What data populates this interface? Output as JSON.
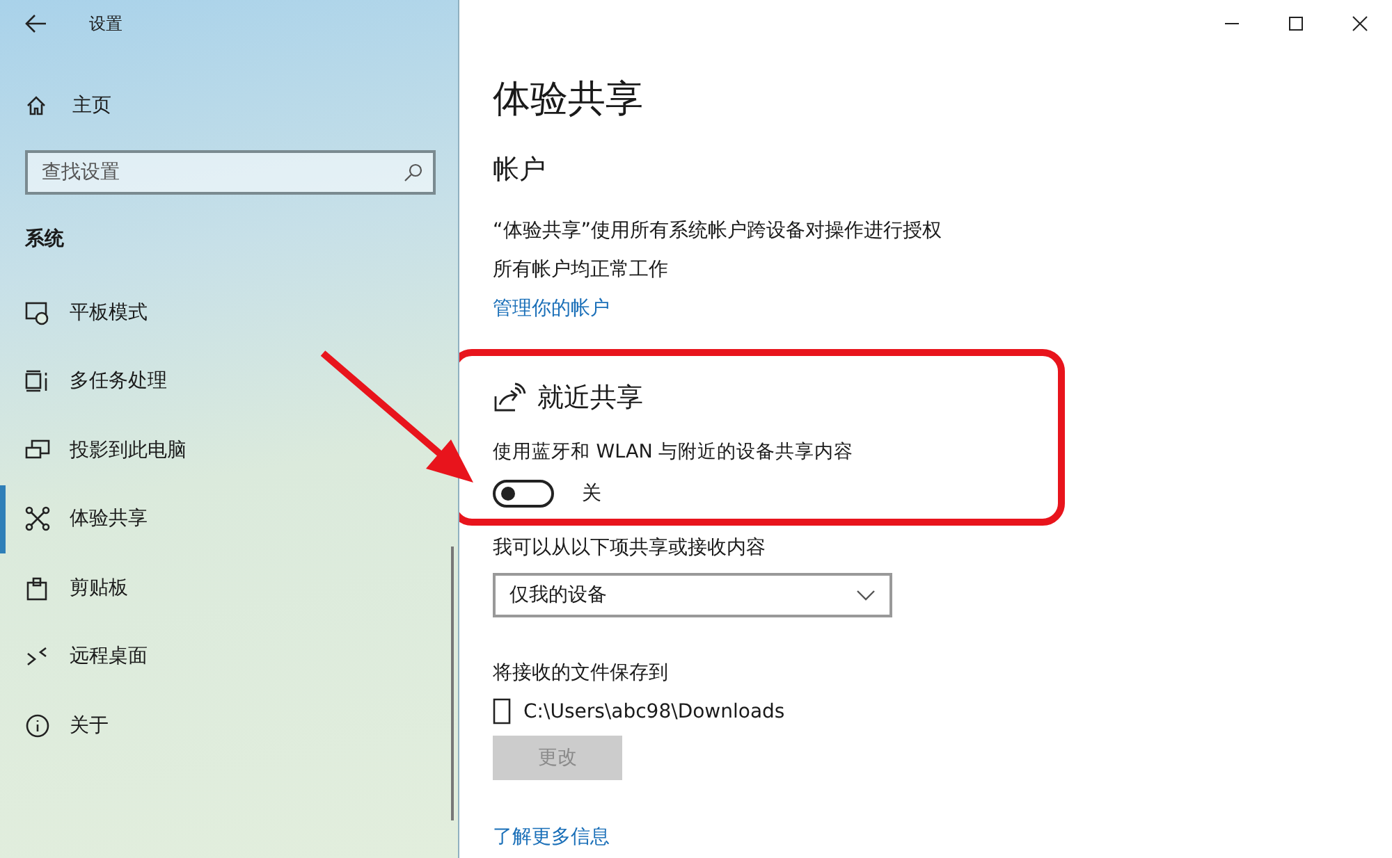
{
  "window": {
    "title": "设置"
  },
  "sidebar": {
    "home": "主页",
    "search": {
      "placeholder": "查找设置"
    },
    "section": "系统",
    "items": [
      {
        "label": "平板模式",
        "selected": false
      },
      {
        "label": "多任务处理",
        "selected": false
      },
      {
        "label": "投影到此电脑",
        "selected": false
      },
      {
        "label": "体验共享",
        "selected": true
      },
      {
        "label": "剪贴板",
        "selected": false
      },
      {
        "label": "远程桌面",
        "selected": false
      },
      {
        "label": "关于",
        "selected": false
      }
    ]
  },
  "page": {
    "title": "体验共享",
    "account": {
      "heading": "帐户",
      "lines": [
        "“体验共享”使用所有系统帐户跨设备对操作进行授权",
        "所有帐户均正常工作"
      ],
      "link": "管理你的帐户"
    },
    "nearby": {
      "heading": "就近共享",
      "description": "使用蓝牙和 WLAN 与附近的设备共享内容",
      "toggle": {
        "on": false,
        "label": "关"
      }
    },
    "share_from": {
      "label": "我可以从以下项共享或接收内容",
      "value": "仅我的设备"
    },
    "save_to": {
      "label": "将接收的文件保存到",
      "path": "C:\\Users\\abc98\\Downloads",
      "button": {
        "label": "更改",
        "disabled": true
      }
    },
    "link": "了解更多信息"
  }
}
